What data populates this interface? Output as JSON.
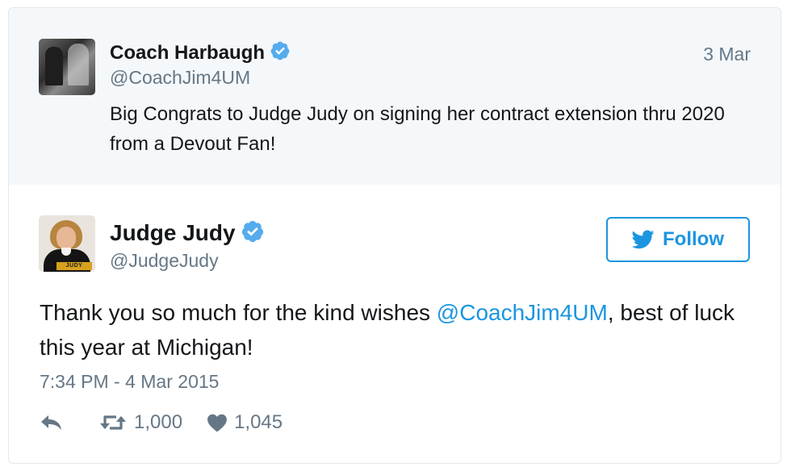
{
  "quoted_tweet": {
    "name": "Coach Harbaugh",
    "handle": "@CoachJim4UM",
    "date": "3 Mar",
    "text": "Big Congrats to Judge Judy on signing her contract extension thru 2020 from a Devout Fan!"
  },
  "tweet": {
    "name": "Judge Judy",
    "handle": "@JudgeJudy",
    "follow_label": "Follow",
    "text_before": "Thank you so much for the kind wishes ",
    "mention": "@CoachJim4UM",
    "text_after": ", best of luck this year at Michigan!",
    "timestamp": "7:34 PM - 4 Mar 2015",
    "retweet_count": "1,000",
    "like_count": "1,045",
    "avatar_banner": "JUDY"
  },
  "icons": {
    "verified": "verified-badge-icon",
    "bird": "twitter-bird-icon",
    "reply": "reply-icon",
    "retweet": "retweet-icon",
    "like": "heart-icon"
  },
  "colors": {
    "accent": "#1b95e0",
    "verified": "#55acee",
    "text": "#14171a",
    "muted": "#657786",
    "quoted_bg": "#f5f8fa"
  }
}
